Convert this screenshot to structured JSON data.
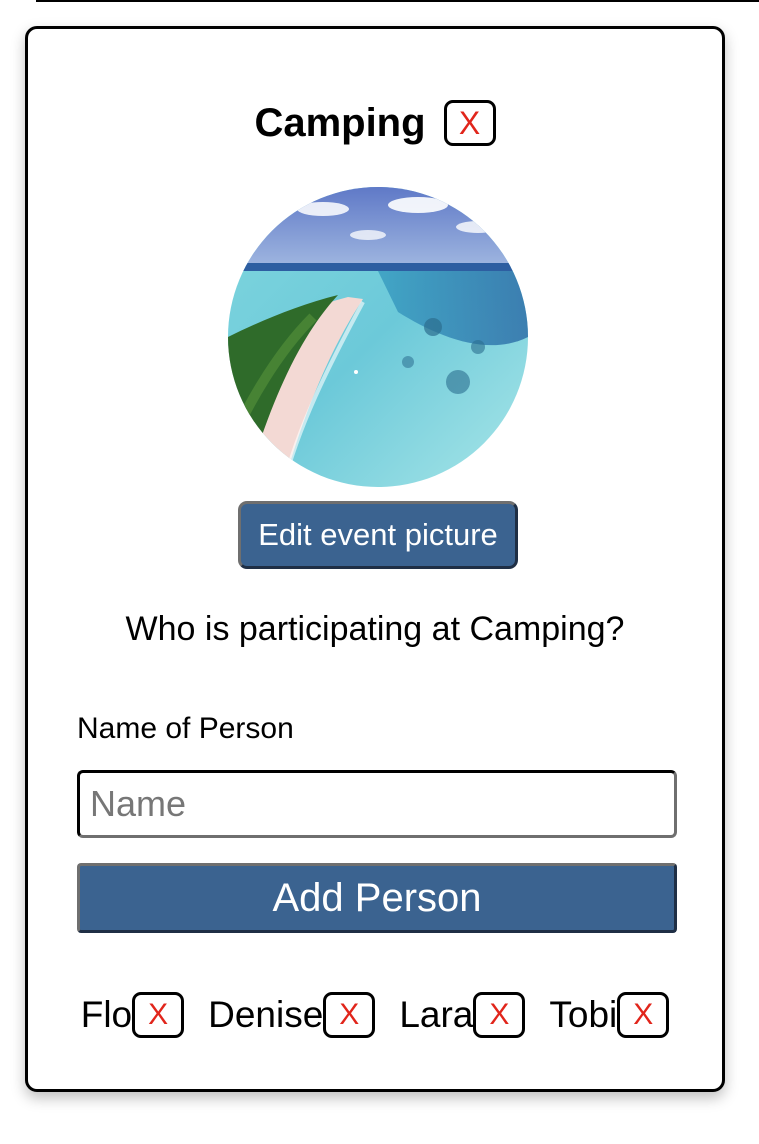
{
  "event": {
    "title": "Camping",
    "remove_label": "X",
    "picture_alt": "Event picture: aerial view of a tropical island with turquoise water",
    "edit_picture_label": "Edit event picture"
  },
  "participants_section": {
    "question": "Who is participating at Camping?",
    "field_label": "Name of Person",
    "input_value": "",
    "input_placeholder": "Name",
    "add_button_label": "Add Person"
  },
  "participants": [
    {
      "name": "Flo",
      "remove_label": "X"
    },
    {
      "name": "Denise",
      "remove_label": "X"
    },
    {
      "name": "Lara",
      "remove_label": "X"
    },
    {
      "name": "Tobi",
      "remove_label": "X"
    }
  ],
  "colors": {
    "button_bg": "#3b6390",
    "remove_x": "#e1251b"
  }
}
